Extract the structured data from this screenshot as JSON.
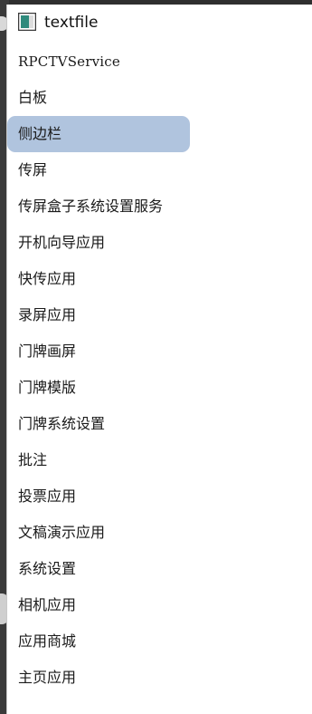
{
  "menu": {
    "title": "textfile",
    "items": [
      {
        "label": "RPCTVService",
        "selected": false
      },
      {
        "label": "白板",
        "selected": false
      },
      {
        "label": "侧边栏",
        "selected": true
      },
      {
        "label": "传屏",
        "selected": false
      },
      {
        "label": "传屏盒子系统设置服务",
        "selected": false
      },
      {
        "label": "开机向导应用",
        "selected": false
      },
      {
        "label": "快传应用",
        "selected": false
      },
      {
        "label": "录屏应用",
        "selected": false
      },
      {
        "label": "门牌画屏",
        "selected": false
      },
      {
        "label": "门牌模版",
        "selected": false
      },
      {
        "label": "门牌系统设置",
        "selected": false
      },
      {
        "label": "批注",
        "selected": false
      },
      {
        "label": "投票应用",
        "selected": false
      },
      {
        "label": "文稿演示应用",
        "selected": false
      },
      {
        "label": "系统设置",
        "selected": false
      },
      {
        "label": "相机应用",
        "selected": false
      },
      {
        "label": "应用商城",
        "selected": false
      },
      {
        "label": "主页应用",
        "selected": false
      }
    ]
  },
  "colors": {
    "selection": "#b0c4de",
    "menu_bg": "#ffffff",
    "text": "#1a1a1a"
  }
}
